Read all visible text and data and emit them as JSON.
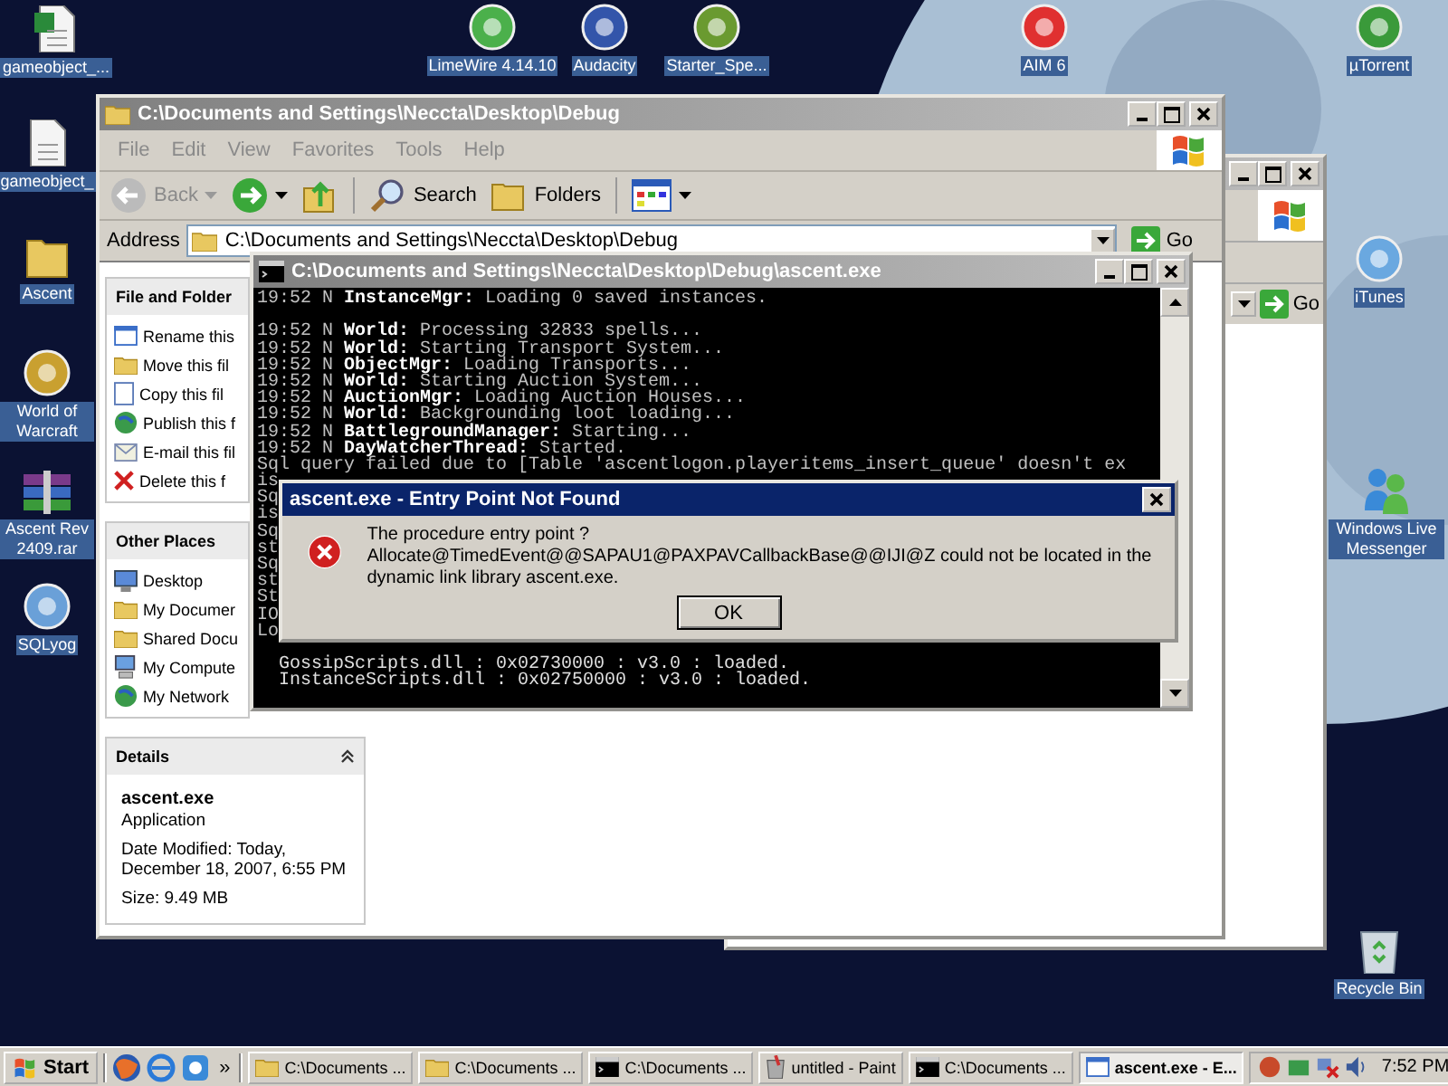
{
  "desktop_icons": [
    {
      "label": "gameobject_..."
    },
    {
      "label": "gameobject_"
    },
    {
      "label": "Ascent"
    },
    {
      "label": "World of Warcraft"
    },
    {
      "label": "Ascent Rev 2409.rar"
    },
    {
      "label": "SQLyog"
    },
    {
      "label": "LimeWire 4.14.10"
    },
    {
      "label": "Audacity"
    },
    {
      "label": "Starter_Spe..."
    },
    {
      "label": "AIM 6"
    },
    {
      "label": "µTorrent"
    },
    {
      "label": "iTunes"
    },
    {
      "label": "Windows Live Messenger"
    },
    {
      "label": "Recycle Bin"
    }
  ],
  "back_window": {
    "go_button": "Go"
  },
  "explorer": {
    "title": "C:\\Documents and Settings\\Neccta\\Desktop\\Debug",
    "menu": [
      "File",
      "Edit",
      "View",
      "Favorites",
      "Tools",
      "Help"
    ],
    "toolbar": {
      "back": "Back",
      "search": "Search",
      "folders": "Folders"
    },
    "address": {
      "label": "Address",
      "value": "C:\\Documents and Settings\\Neccta\\Desktop\\Debug",
      "go": "Go"
    },
    "task_pane": {
      "file_tasks": {
        "title": "File and Folder",
        "items": [
          "Rename this",
          "Move this fil",
          "Copy this fil",
          "Publish this f",
          "E-mail this fil",
          "Delete this f"
        ]
      },
      "other_places": {
        "title": "Other Places",
        "items": [
          "Desktop",
          "My Documer",
          "Shared Docu",
          "My Compute",
          "My Network"
        ]
      },
      "details": {
        "title": "Details",
        "name": "ascent.exe",
        "type": "Application",
        "modified": "Date Modified: Today, December 18, 2007, 6:55 PM",
        "size": "Size: 9.49 MB"
      }
    }
  },
  "console": {
    "title": "C:\\Documents and Settings\\Neccta\\Desktop\\Debug\\ascent.exe",
    "lines": [
      {
        "kind": "log",
        "text": "19:52 N **InstanceMgr:** Loading 0 saved instances."
      },
      {
        "kind": "blank"
      },
      {
        "kind": "log",
        "text": "19:52 N **World:** Processing 32833 spells..."
      },
      {
        "kind": "log",
        "text": "19:52 N **World:** Starting Transport System..."
      },
      {
        "kind": "log",
        "text": "19:52 N **ObjectMgr:** Loading Transports..."
      },
      {
        "kind": "log",
        "text": "19:52 N **World:** Starting Auction System..."
      },
      {
        "kind": "log",
        "text": "19:52 N **AuctionMgr:** Loading Auction Houses..."
      },
      {
        "kind": "log",
        "text": "19:52 N **World:** Backgrounding loot loading..."
      },
      {
        "kind": "log",
        "text": "19:52 N **BattlegroundManager:** Starting..."
      },
      {
        "kind": "log",
        "text": "19:52 N **DayWatcherThread:** Started."
      },
      {
        "kind": "log",
        "text": "Sql query failed due to [Table 'ascentlogon.playeritems_insert_queue' doesn't ex"
      },
      {
        "kind": "log",
        "text": "is"
      },
      {
        "kind": "log",
        "text": "Sq"
      },
      {
        "kind": "log",
        "text": "is"
      },
      {
        "kind": "log",
        "text": "Sq"
      },
      {
        "kind": "log",
        "text": "st"
      },
      {
        "kind": "log",
        "text": "Sq"
      },
      {
        "kind": "log",
        "text": "st"
      },
      {
        "kind": "log",
        "text": "St"
      },
      {
        "kind": "log",
        "text": "IO"
      },
      {
        "kind": "log",
        "text": "Lo"
      },
      {
        "kind": "blank"
      },
      {
        "kind": "module",
        "text": "GossipScripts.dll : 0x02730000 : v3.0 : loaded."
      },
      {
        "kind": "module",
        "text": "InstanceScripts.dll : 0x02750000 : v3.0 : loaded."
      }
    ]
  },
  "dialog": {
    "title": "ascent.exe - Entry Point Not Found",
    "message": "The procedure entry point ?Allocate@TimedEvent@@SAPAU1@PAXPAVCallbackBase@@IJI@Z could not be located in the dynamic link library ascent.exe.",
    "button": "OK"
  },
  "taskbar": {
    "start": "Start",
    "overflow": "»",
    "buttons": [
      {
        "label": "C:\\Documents ...",
        "selected": false
      },
      {
        "label": "C:\\Documents ...",
        "selected": false
      },
      {
        "label": "C:\\Documents ...",
        "selected": false
      },
      {
        "label": "untitled - Paint",
        "selected": false
      },
      {
        "label": "C:\\Documents ...",
        "selected": false
      },
      {
        "label": "ascent.exe - E...",
        "selected": true
      }
    ],
    "clock": "7:52 PM"
  }
}
